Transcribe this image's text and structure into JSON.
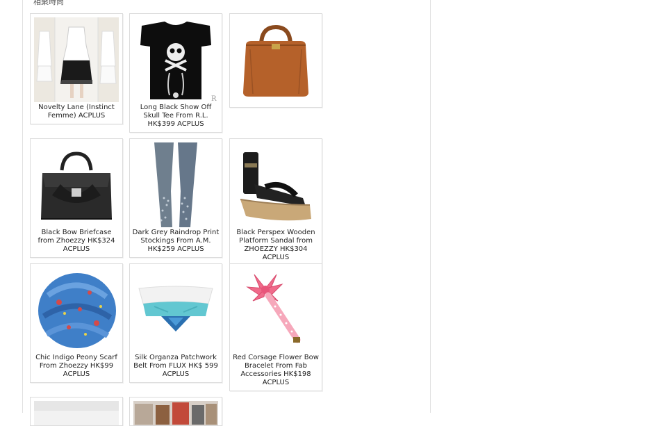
{
  "page": {
    "header_text": "相聚時尚"
  },
  "items": [
    {
      "caption": "Novelty Lane (Instinct Femme) ACPLUS",
      "icon": "white-dress-photo"
    },
    {
      "caption": "Long Black Show Off Skull Tee From R.L. HK$399 ACPLUS",
      "icon": "skull-tee-photo"
    },
    {
      "caption": "",
      "icon": "brown-bag-photo"
    },
    {
      "caption": "Black Bow Briefcase from Zhoezzy HK$324 ACPLUS",
      "icon": "black-briefcase-photo"
    },
    {
      "caption": "Dark Grey Raindrop Print Stockings From A.M. HK$259 ACPLUS",
      "icon": "grey-stockings-photo"
    },
    {
      "caption": "Black Perspex Wooden Platform Sandal from ZHOEZZY HK$304 ACPLUS",
      "icon": "platform-sandal-photo"
    },
    {
      "caption": "Chic Indigo Peony Scarf From Zhoezzy HK$99 ACPLUS",
      "icon": "indigo-scarf-photo"
    },
    {
      "caption": "Silk Organza Patchwork Belt From FLUX HK$ 599 ACPLUS",
      "icon": "organza-belt-photo"
    },
    {
      "caption": "Red Corsage Flower Bow Bracelet From Fab Accessories HK$198 ACPLUS",
      "icon": "bow-bracelet-photo"
    },
    {
      "caption": "",
      "icon": "product-photo"
    },
    {
      "caption": "",
      "icon": "product-photo"
    }
  ]
}
